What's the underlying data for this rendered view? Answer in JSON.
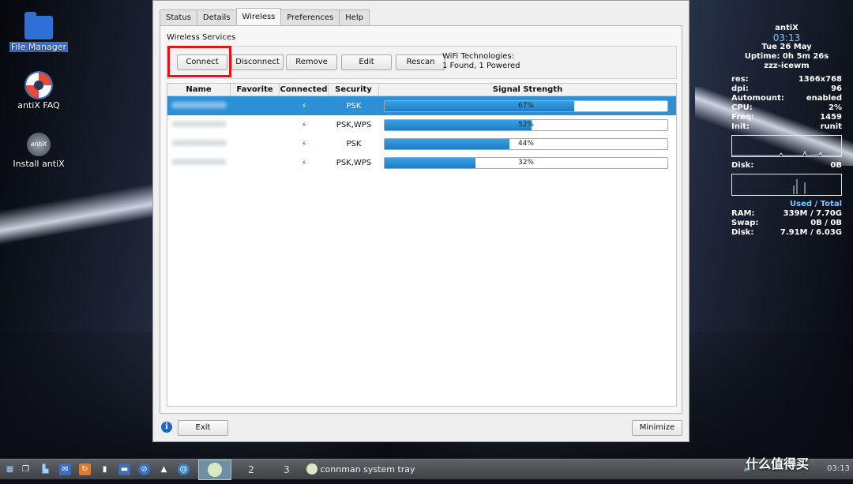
{
  "desktop": {
    "icons": [
      {
        "label": "File Manager",
        "icon": "folder-icon"
      },
      {
        "label": "antiX FAQ",
        "icon": "lifebuoy-icon"
      },
      {
        "label": "Install antiX",
        "icon": "antix-logo-icon"
      }
    ]
  },
  "conky": {
    "host": "antiX",
    "time": "03:13",
    "date": "Tue 26 May",
    "uptime": "Uptime: 0h 5m 26s",
    "wm": "zzz-icewm",
    "stats": [
      {
        "label": "res:",
        "value": "1366x768"
      },
      {
        "label": "dpi:",
        "value": "96"
      },
      {
        "label": "Automount:",
        "value": "enabled"
      },
      {
        "label": "CPU:",
        "value": "2%"
      },
      {
        "label": "Freq:",
        "value": "1459"
      },
      {
        "label": "Init:",
        "value": "runit"
      }
    ],
    "disk_label": "Disk:",
    "disk_value": "0B",
    "used_total": "Used / Total",
    "usage": [
      {
        "label": "RAM:",
        "value": "339M  / 7.70G"
      },
      {
        "label": "Swap:",
        "value": "0B   / 0B"
      },
      {
        "label": "Disk:",
        "value": "7.91M / 6.03G"
      }
    ]
  },
  "dialog": {
    "tabs": [
      {
        "label": "Status",
        "active": false
      },
      {
        "label": "Details",
        "active": false
      },
      {
        "label": "Wireless",
        "active": true
      },
      {
        "label": "Preferences",
        "active": false
      },
      {
        "label": "Help",
        "active": false
      }
    ],
    "group_title": "Wireless Services",
    "buttons": {
      "connect": "Connect",
      "disconnect": "Disconnect",
      "remove": "Remove",
      "edit": "Edit",
      "rescan": "Rescan"
    },
    "wifi_tech_line1": "WiFi Technologies:",
    "wifi_tech_line2": "1 Found, 1 Powered",
    "columns": [
      "Name",
      "Favorite",
      "Connected",
      "Security",
      "Signal Strength"
    ],
    "rows": [
      {
        "security": "PSK",
        "signal": 67,
        "signal_label": "67%",
        "selected": true
      },
      {
        "security": "PSK,WPS",
        "signal": 52,
        "signal_label": "52%",
        "selected": false
      },
      {
        "security": "PSK",
        "signal": 44,
        "signal_label": "44%",
        "selected": false
      },
      {
        "security": "PSK,WPS",
        "signal": 32,
        "signal_label": "32%",
        "selected": false
      }
    ],
    "exit_label": "Exit",
    "minimize_label": "Minimize"
  },
  "taskbar": {
    "workspaces": [
      "2",
      "3"
    ],
    "task_label": "connman system tray",
    "clock": "03:13"
  },
  "watermark": "什么值得买",
  "colors": {
    "highlight": "#e3141c",
    "selection": "#2d8fd5",
    "signal_fill": "#1f7cc4"
  }
}
